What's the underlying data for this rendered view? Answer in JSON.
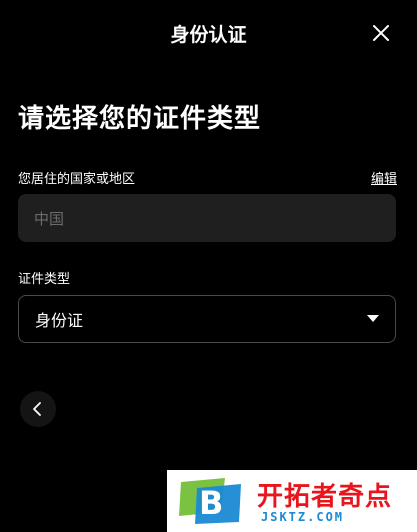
{
  "header": {
    "title": "身份认证",
    "close_icon": "close-icon"
  },
  "page": {
    "heading": "请选择您的证件类型"
  },
  "country": {
    "label": "您居住的国家或地区",
    "edit_label": "编辑",
    "value": "中国"
  },
  "id_type": {
    "label": "证件类型",
    "selected": "身份证",
    "dropdown_icon": "caret-down-icon"
  },
  "navigation": {
    "back_icon": "chevron-left-icon"
  },
  "watermark": {
    "logo_letter": "B",
    "brand_text": "开拓者奇点",
    "url": "JSKTZ.COM",
    "colors": {
      "green": "#7cc242",
      "blue": "#1a8ad4",
      "red": "#e8161c"
    }
  },
  "colors": {
    "background": "#000000",
    "field_background": "#1f1f1f",
    "placeholder_text": "#6b6b6b",
    "border": "#4a4a4a"
  }
}
